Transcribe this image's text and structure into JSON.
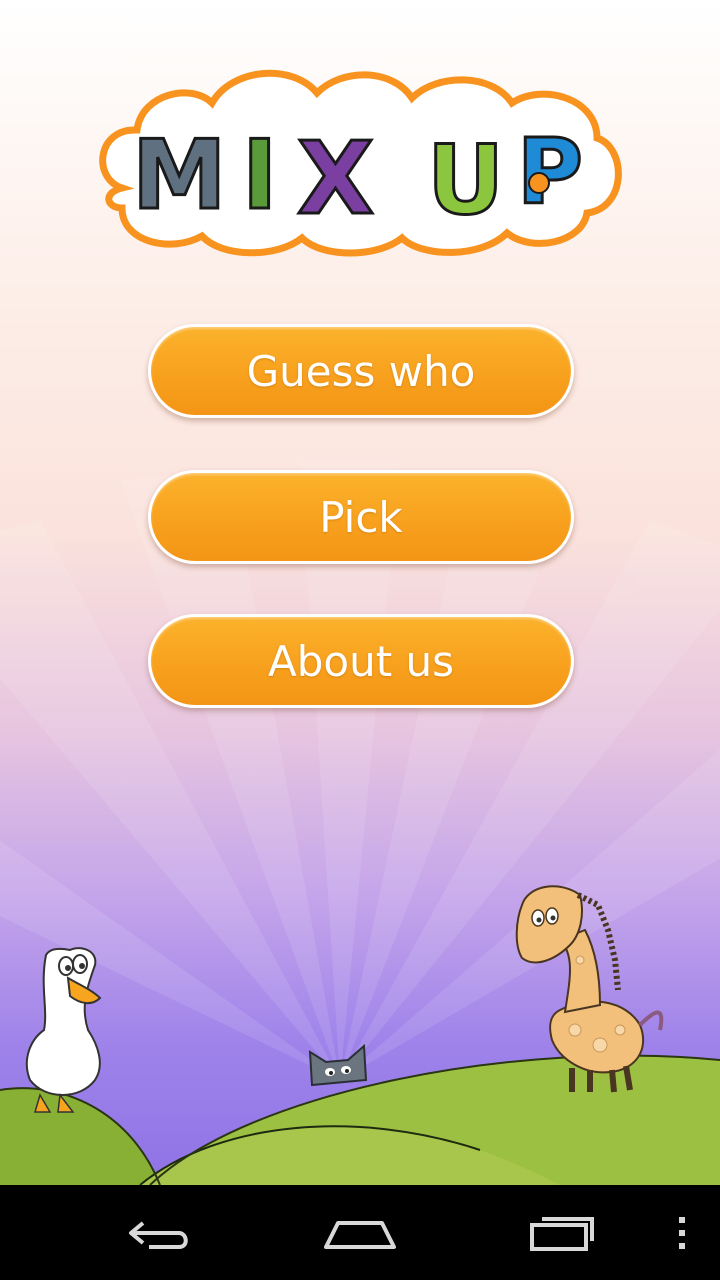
{
  "logo": {
    "letters": [
      "M",
      "I",
      "X",
      "U",
      "P"
    ],
    "cloud_color": "#f7931e",
    "icon": "mix-up-logo"
  },
  "menu": {
    "guess_label": "Guess who",
    "pick_label": "Pick",
    "about_label": "About us",
    "button_color": "#f8a11e"
  },
  "scene": {
    "characters": [
      "goose",
      "cat",
      "giraffe"
    ],
    "hill_color": "#8fb53a"
  },
  "navbar": {
    "back_icon": "back-arrow-icon",
    "home_icon": "home-icon",
    "recents_icon": "recent-apps-icon",
    "menu_icon": "overflow-menu-icon"
  }
}
